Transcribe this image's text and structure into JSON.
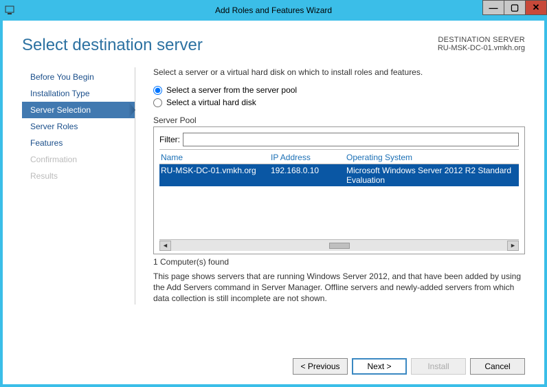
{
  "window": {
    "title": "Add Roles and Features Wizard"
  },
  "header": {
    "page_title": "Select destination server",
    "dest_label": "DESTINATION SERVER",
    "dest_value": "RU-MSK-DC-01.vmkh.org"
  },
  "sidebar": {
    "items": [
      {
        "label": "Before You Begin",
        "state": "normal"
      },
      {
        "label": "Installation Type",
        "state": "normal"
      },
      {
        "label": "Server Selection",
        "state": "active"
      },
      {
        "label": "Server Roles",
        "state": "normal"
      },
      {
        "label": "Features",
        "state": "normal"
      },
      {
        "label": "Confirmation",
        "state": "disabled"
      },
      {
        "label": "Results",
        "state": "disabled"
      }
    ]
  },
  "content": {
    "instruction": "Select a server or a virtual hard disk on which to install roles and features.",
    "radio1": "Select a server from the server pool",
    "radio2": "Select a virtual hard disk",
    "pool_label": "Server Pool",
    "filter_label": "Filter:",
    "filter_value": "",
    "columns": {
      "name": "Name",
      "ip": "IP Address",
      "os": "Operating System"
    },
    "rows": [
      {
        "name": "RU-MSK-DC-01.vmkh.org",
        "ip": "192.168.0.10",
        "os": "Microsoft Windows Server 2012 R2 Standard Evaluation"
      }
    ],
    "count_text": "1 Computer(s) found",
    "note": "This page shows servers that are running Windows Server 2012, and that have been added by using the Add Servers command in Server Manager. Offline servers and newly-added servers from which data collection is still incomplete are not shown."
  },
  "footer": {
    "previous": "< Previous",
    "next": "Next >",
    "install": "Install",
    "cancel": "Cancel"
  }
}
